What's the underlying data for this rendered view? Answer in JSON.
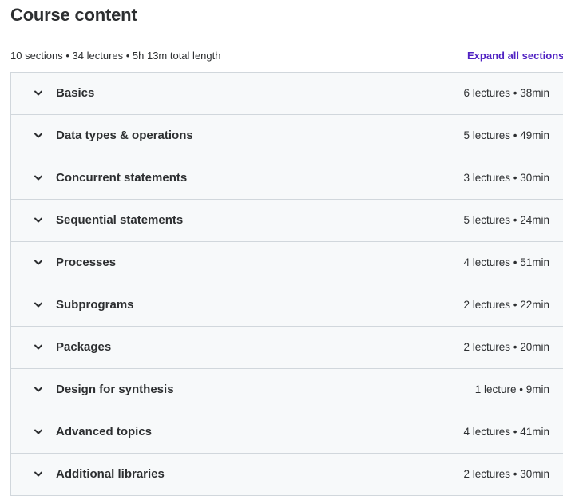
{
  "page_title": "Course content",
  "summary": "10 sections • 34 lectures • 5h 13m total length",
  "expand_all_label": "Expand all sections",
  "sections": [
    {
      "title": "Basics",
      "meta": "6 lectures • 38min"
    },
    {
      "title": "Data types & operations",
      "meta": "5 lectures • 49min"
    },
    {
      "title": "Concurrent statements",
      "meta": "3 lectures • 30min"
    },
    {
      "title": "Sequential statements",
      "meta": "5 lectures • 24min"
    },
    {
      "title": "Processes",
      "meta": "4 lectures • 51min"
    },
    {
      "title": "Subprograms",
      "meta": "2 lectures • 22min"
    },
    {
      "title": "Packages",
      "meta": "2 lectures • 20min"
    },
    {
      "title": "Design for synthesis",
      "meta": "1 lecture • 9min"
    },
    {
      "title": "Advanced topics",
      "meta": "4 lectures • 41min"
    },
    {
      "title": "Additional libraries",
      "meta": "2 lectures • 30min"
    }
  ],
  "colors": {
    "accent": "#5022c3",
    "section_bg": "#f7f9fa",
    "border": "#d1d7dc",
    "text": "#2d2f31"
  },
  "icons": {
    "section_toggle": "chevron-down-icon"
  }
}
